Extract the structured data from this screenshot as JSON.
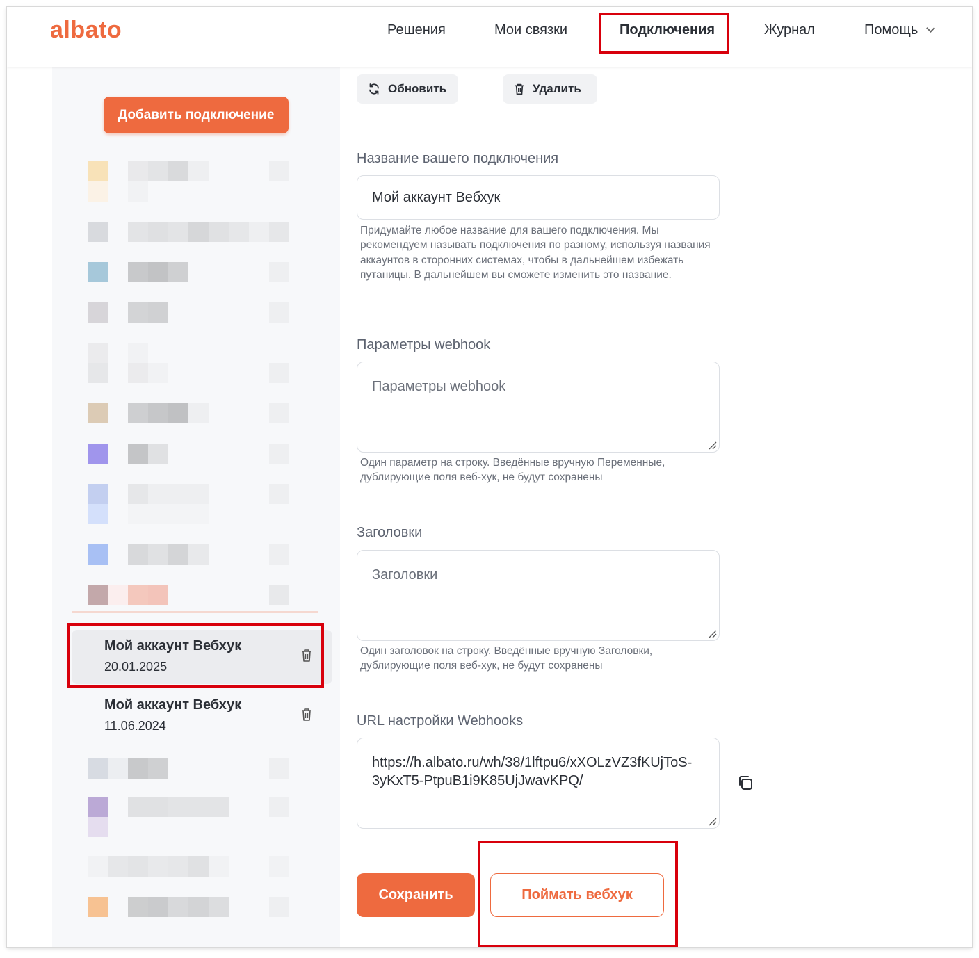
{
  "app": {
    "logo": "albato"
  },
  "nav": {
    "items": [
      {
        "label": "Решения"
      },
      {
        "label": "Мои связки"
      },
      {
        "label": "Подключения"
      },
      {
        "label": "Журнал"
      },
      {
        "label": "Помощь"
      }
    ]
  },
  "sidebar": {
    "add_button": "Добавить подключение",
    "connections": [
      {
        "name": "Мой аккаунт Вебхук",
        "date": "20.01.2025",
        "selected": true
      },
      {
        "name": "Мой аккаунт Вебхук",
        "date": "11.06.2024",
        "selected": false
      }
    ]
  },
  "toolbar": {
    "refresh_label": "Обновить",
    "delete_label": "Удалить"
  },
  "form": {
    "name": {
      "label": "Название вашего подключения",
      "value": "Мой аккаунт Вебхук",
      "help": "Придумайте любое название для вашего подключения. Мы рекомендуем называть подключения по разному, используя названия аккаунтов в сторонних системах, чтобы в дальнейшем избежать путаницы. В дальнейшем вы сможете изменить это название."
    },
    "params": {
      "label": "Параметры webhook",
      "placeholder": "Параметры webhook",
      "help": "Один параметр на строку. Введённые вручную Переменные, дублирующие поля веб-хук, не будут сохранены"
    },
    "headers": {
      "label": "Заголовки",
      "placeholder": "Заголовки",
      "help": "Один заголовок на строку. Введённые вручную Заголовки, дублирующие поля веб-хук, не будут сохранены"
    },
    "url": {
      "label": "URL настройки Webhooks",
      "value": "https://h.albato.ru/wh/38/1lftpu6/xXOLzVZ3fKUjToS-3yKxT5-PtpuB1i9K85UjJwavKPQ/"
    },
    "save_label": "Сохранить",
    "catch_label": "Поймать вебхук"
  },
  "colors": {
    "accent": "#ee6a3f",
    "highlight": "#d8000c",
    "sidebar_bg": "#f7f8fa"
  },
  "icons": [
    "refresh-icon",
    "trash-icon",
    "copy-icon",
    "chevron-down-icon",
    "resize-grip-icon"
  ]
}
